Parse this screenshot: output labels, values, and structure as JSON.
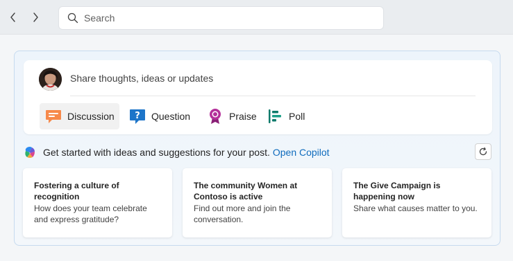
{
  "search": {
    "placeholder": "Search"
  },
  "composer": {
    "prompt": "Share thoughts, ideas or updates",
    "post_types": [
      {
        "label": "Discussion",
        "icon": "discussion-icon",
        "color": "#f7894a"
      },
      {
        "label": "Question",
        "icon": "question-icon",
        "color": "#1d75c9"
      },
      {
        "label": "Praise",
        "icon": "praise-icon",
        "color": "#b4309a"
      },
      {
        "label": "Poll",
        "icon": "poll-icon",
        "color": "#0f7a6b"
      }
    ]
  },
  "copilot": {
    "text": "Get started with ideas and suggestions for your post.",
    "link": "Open Copilot"
  },
  "suggestions": [
    {
      "title": "Fostering a culture of recognition",
      "description": "How does your team celebrate and express gratitude?"
    },
    {
      "title": "The community Women at Contoso is active",
      "description": "Find out more and join the conversation."
    },
    {
      "title": "The Give Campaign is happening now",
      "description": "Share what causes matter to you."
    }
  ],
  "colors": {
    "accent": "#0f6cbd",
    "panel_border": "#c6daef",
    "panel_bg": "#edf4fb"
  }
}
